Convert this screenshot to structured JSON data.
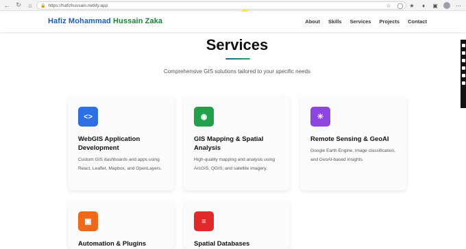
{
  "browser": {
    "url": "https://hafizhussain.netlify.app"
  },
  "site": {
    "brand_first": "Hafiz Mohammad ",
    "brand_second": "Hussain Zaka",
    "nav": [
      "About",
      "Skills",
      "Services",
      "Projects",
      "Contact"
    ]
  },
  "services": {
    "title": "Services",
    "subtitle": "Comprehensive GIS solutions tailored to your specific needs",
    "cards": [
      {
        "title": "WebGIS Application Development",
        "desc": "Custom GIS dashboards and apps using React, Leaflet, Mapbox, and OpenLayers.",
        "color": "#2f6fe4",
        "icon": "code-icon",
        "glyph": "<>"
      },
      {
        "title": "GIS Mapping & Spatial Analysis",
        "desc": "High-quality mapping and analysis using ArcGIS, QGIS, and satellite imagery.",
        "color": "#22a04b",
        "icon": "map-pin-icon",
        "glyph": "◉"
      },
      {
        "title": "Remote Sensing & GeoAI",
        "desc": "Google Earth Engine, image classification, and GeoAI-based insights.",
        "color": "#8e44e0",
        "icon": "satellite-icon",
        "glyph": "✳"
      },
      {
        "title": "Automation & Plugins",
        "desc": "",
        "color": "#ee6a1a",
        "icon": "cpu-icon",
        "glyph": "▣"
      },
      {
        "title": "Spatial Databases",
        "desc": "",
        "color": "#e02a2a",
        "icon": "database-icon",
        "glyph": "≡"
      }
    ]
  }
}
